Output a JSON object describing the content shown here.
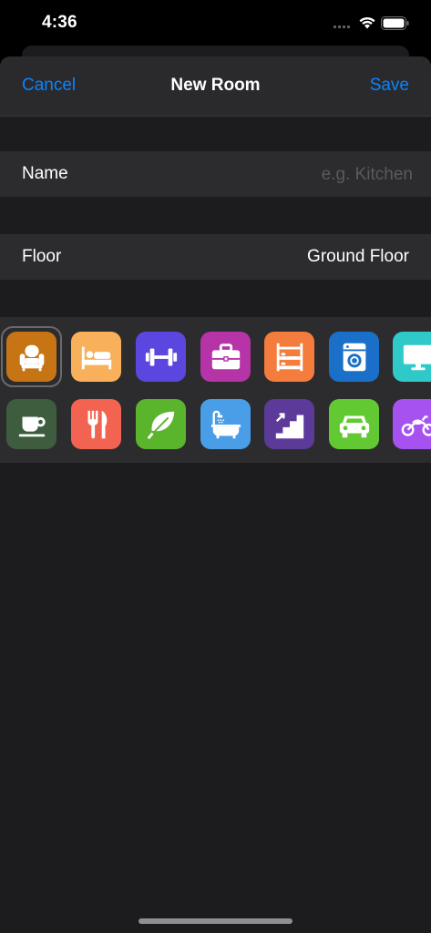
{
  "status_bar": {
    "time": "4:36"
  },
  "nav": {
    "cancel": "Cancel",
    "title": "New Room",
    "save": "Save"
  },
  "form": {
    "name_label": "Name",
    "name_placeholder": "e.g. Kitchen",
    "name_value": "",
    "floor_label": "Floor",
    "floor_value": "Ground Floor"
  },
  "room_icons": [
    {
      "icon": "armchair-icon",
      "color": "#c67414",
      "selected": true
    },
    {
      "icon": "bed-icon",
      "color": "#f9b05b"
    },
    {
      "icon": "dumbbell-icon",
      "color": "#5b47e0"
    },
    {
      "icon": "briefcase-icon",
      "color": "#b633a8"
    },
    {
      "icon": "bunk-bed-icon",
      "color": "#f47c3c"
    },
    {
      "icon": "washing-machine-icon",
      "color": "#1a70c8"
    },
    {
      "icon": "monitor-icon",
      "color": "#30c9c9"
    },
    {
      "icon": "coffee-cup-icon",
      "color": "#3e5d3e"
    },
    {
      "icon": "fork-knife-icon",
      "color": "#f26451"
    },
    {
      "icon": "leaf-icon",
      "color": "#5ab52d"
    },
    {
      "icon": "bathtub-icon",
      "color": "#4a9ee8"
    },
    {
      "icon": "stairs-icon",
      "color": "#5b3a9a"
    },
    {
      "icon": "car-icon",
      "color": "#63c933"
    },
    {
      "icon": "motorcycle-icon",
      "color": "#a652f0"
    }
  ]
}
